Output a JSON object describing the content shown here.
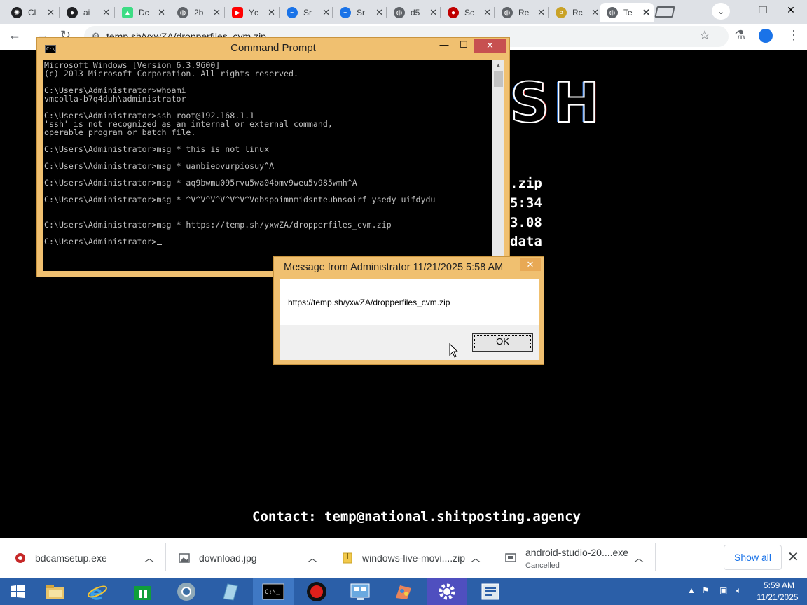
{
  "browser": {
    "tabs": [
      {
        "label": "Cl",
        "icon": "openai-icon",
        "color": "#202124"
      },
      {
        "label": "ai",
        "icon": "github-icon",
        "color": "#202124"
      },
      {
        "label": "Dc",
        "icon": "android-icon",
        "color": "#3ddc84"
      },
      {
        "label": "2b",
        "icon": "globe-icon",
        "color": "#5f6368"
      },
      {
        "label": "Yc",
        "icon": "youtube-icon",
        "color": "#ff0000"
      },
      {
        "label": "Sr",
        "icon": "swift-icon",
        "color": "#1a73e8"
      },
      {
        "label": "Sr",
        "icon": "swift-icon",
        "color": "#1a73e8"
      },
      {
        "label": "d5",
        "icon": "globe-icon",
        "color": "#5f6368"
      },
      {
        "label": "Sc",
        "icon": "record-icon",
        "color": "#c00000"
      },
      {
        "label": "Re",
        "icon": "globe-icon",
        "color": "#5f6368"
      },
      {
        "label": "Rc",
        "icon": "coin-icon",
        "color": "#c9a227"
      },
      {
        "label": "Te",
        "icon": "globe-icon",
        "color": "#5f6368"
      }
    ],
    "url": "temp.sh/yxwZA/dropperfiles_cvm.zip"
  },
  "page": {
    "logo_text": "SH",
    "lines": [
      ".zip",
      "5:34",
      "3.08",
      "data"
    ],
    "contact": "Contact: temp@national.shitposting.agency"
  },
  "cmd": {
    "title": "Command Prompt",
    "icon_text": "C:\\.",
    "lines": [
      "Microsoft Windows [Version 6.3.9600]",
      "(c) 2013 Microsoft Corporation. All rights reserved.",
      "",
      "C:\\Users\\Administrator>whoami",
      "vmcolla-b7q4duh\\administrator",
      "",
      "C:\\Users\\Administrator>ssh root@192.168.1.1",
      "'ssh' is not recognized as an internal or external command,",
      "operable program or batch file.",
      "",
      "C:\\Users\\Administrator>msg * this is not linux",
      "",
      "C:\\Users\\Administrator>msg * uanbieovurpiosuy^A",
      "",
      "C:\\Users\\Administrator>msg * aq9bwmu095rvu5wa04bmv9weu5v985wmh^A",
      "",
      "C:\\Users\\Administrator>msg * ^V^V^V^V^V^V^Vdbspoimnmidsnteubnsoirf ysedy uifdydu",
      "",
      "",
      "C:\\Users\\Administrator>msg * https://temp.sh/yxwZA/dropperfiles_cvm.zip",
      ""
    ],
    "prompt": "C:\\Users\\Administrator>"
  },
  "message": {
    "title": "Message from Administrator 11/21/2025 5:58 AM",
    "text": "https://temp.sh/yxwZA/dropperfiles_cvm.zip",
    "ok_label": "OK"
  },
  "downloads": {
    "items": [
      {
        "name": "bdcamsetup.exe",
        "status": "",
        "icon": "bandicam-icon"
      },
      {
        "name": "download.jpg",
        "status": "",
        "icon": "image-file-icon"
      },
      {
        "name": "windows-live-movi....zip",
        "status": "",
        "icon": "zip-file-icon"
      },
      {
        "name": "android-studio-20....exe",
        "status": "Cancelled",
        "icon": "installer-icon"
      }
    ],
    "show_all_label": "Show all"
  },
  "taskbar": {
    "time": "5:59 AM",
    "date": "11/21/2025",
    "apps": [
      "start-icon",
      "file-explorer-icon",
      "internet-explorer-icon",
      "store-icon",
      "chrome-icon",
      "notepad-icon",
      "cmd-icon",
      "record-icon",
      "remote-desktop-icon",
      "paint-icon",
      "settings-icon",
      "media-icon"
    ]
  }
}
